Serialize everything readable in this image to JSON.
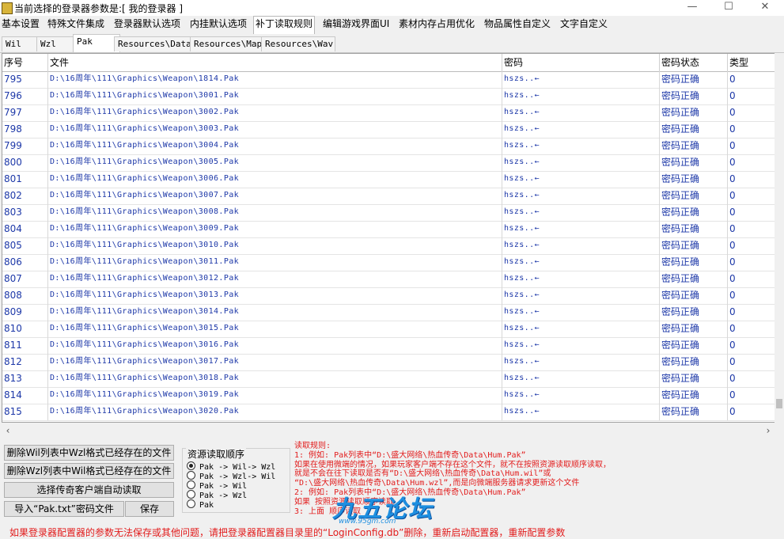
{
  "window": {
    "title": "当前选择的登录器参数是:[ 我的登录器 ]",
    "minimize": "—",
    "maximize": "☐",
    "close": "✕"
  },
  "main_tabs": [
    "基本设置",
    "特殊文件集成",
    "登录器默认选项",
    "内挂默认选项",
    "补丁读取规则",
    "编辑游戏界面UI",
    "素材内存占用优化",
    "物品属性自定义",
    "文字自定义"
  ],
  "active_main_tab": 4,
  "sub_tabs": [
    "Wil",
    "Wzl",
    "Pak",
    "Resources\\Data",
    "Resources\\Map",
    "Resources\\Wav"
  ],
  "active_sub_tab": 2,
  "table": {
    "headers": [
      "序号",
      "文件",
      "密码",
      "密码状态",
      "类型"
    ],
    "rows": [
      {
        "id": "795",
        "file": "D:\\16周年\\111\\Graphics\\Weapon\\1814.Pak",
        "password": "hszs..←",
        "status": "密码正确",
        "type": "0"
      },
      {
        "id": "796",
        "file": "D:\\16周年\\111\\Graphics\\Weapon\\3001.Pak",
        "password": "hszs..←",
        "status": "密码正确",
        "type": "0"
      },
      {
        "id": "797",
        "file": "D:\\16周年\\111\\Graphics\\Weapon\\3002.Pak",
        "password": "hszs..←",
        "status": "密码正确",
        "type": "0"
      },
      {
        "id": "798",
        "file": "D:\\16周年\\111\\Graphics\\Weapon\\3003.Pak",
        "password": "hszs..←",
        "status": "密码正确",
        "type": "0"
      },
      {
        "id": "799",
        "file": "D:\\16周年\\111\\Graphics\\Weapon\\3004.Pak",
        "password": "hszs..←",
        "status": "密码正确",
        "type": "0"
      },
      {
        "id": "800",
        "file": "D:\\16周年\\111\\Graphics\\Weapon\\3005.Pak",
        "password": "hszs..←",
        "status": "密码正确",
        "type": "0"
      },
      {
        "id": "801",
        "file": "D:\\16周年\\111\\Graphics\\Weapon\\3006.Pak",
        "password": "hszs..←",
        "status": "密码正确",
        "type": "0"
      },
      {
        "id": "802",
        "file": "D:\\16周年\\111\\Graphics\\Weapon\\3007.Pak",
        "password": "hszs..←",
        "status": "密码正确",
        "type": "0"
      },
      {
        "id": "803",
        "file": "D:\\16周年\\111\\Graphics\\Weapon\\3008.Pak",
        "password": "hszs..←",
        "status": "密码正确",
        "type": "0"
      },
      {
        "id": "804",
        "file": "D:\\16周年\\111\\Graphics\\Weapon\\3009.Pak",
        "password": "hszs..←",
        "status": "密码正确",
        "type": "0"
      },
      {
        "id": "805",
        "file": "D:\\16周年\\111\\Graphics\\Weapon\\3010.Pak",
        "password": "hszs..←",
        "status": "密码正确",
        "type": "0"
      },
      {
        "id": "806",
        "file": "D:\\16周年\\111\\Graphics\\Weapon\\3011.Pak",
        "password": "hszs..←",
        "status": "密码正确",
        "type": "0"
      },
      {
        "id": "807",
        "file": "D:\\16周年\\111\\Graphics\\Weapon\\3012.Pak",
        "password": "hszs..←",
        "status": "密码正确",
        "type": "0"
      },
      {
        "id": "808",
        "file": "D:\\16周年\\111\\Graphics\\Weapon\\3013.Pak",
        "password": "hszs..←",
        "status": "密码正确",
        "type": "0"
      },
      {
        "id": "809",
        "file": "D:\\16周年\\111\\Graphics\\Weapon\\3014.Pak",
        "password": "hszs..←",
        "status": "密码正确",
        "type": "0"
      },
      {
        "id": "810",
        "file": "D:\\16周年\\111\\Graphics\\Weapon\\3015.Pak",
        "password": "hszs..←",
        "status": "密码正确",
        "type": "0"
      },
      {
        "id": "811",
        "file": "D:\\16周年\\111\\Graphics\\Weapon\\3016.Pak",
        "password": "hszs..←",
        "status": "密码正确",
        "type": "0"
      },
      {
        "id": "812",
        "file": "D:\\16周年\\111\\Graphics\\Weapon\\3017.Pak",
        "password": "hszs..←",
        "status": "密码正确",
        "type": "0"
      },
      {
        "id": "813",
        "file": "D:\\16周年\\111\\Graphics\\Weapon\\3018.Pak",
        "password": "hszs..←",
        "status": "密码正确",
        "type": "0"
      },
      {
        "id": "814",
        "file": "D:\\16周年\\111\\Graphics\\Weapon\\3019.Pak",
        "password": "hszs..←",
        "status": "密码正确",
        "type": "0"
      },
      {
        "id": "815",
        "file": "D:\\16周年\\111\\Graphics\\Weapon\\3020.Pak",
        "password": "hszs..←",
        "status": "密码正确",
        "type": "0"
      }
    ]
  },
  "scroll": {
    "left_arrow": "‹",
    "right_arrow": "›"
  },
  "buttons": {
    "delete_wil": "删除Wil列表中Wzl格式已经存在的文件",
    "delete_wzl": "删除Wzl列表中Wil格式已经存在的文件",
    "select_client": "选择传奇客户端自动读取",
    "import_pak": "导入“Pak.txt”密码文件",
    "save": "保存"
  },
  "resource_order": {
    "title": "资源读取顺序",
    "options": [
      "Pak -> Wil-> Wzl",
      "Pak -> Wzl-> Wil",
      "Pak -> Wil",
      "Pak -> Wzl",
      "Pak"
    ],
    "selected": 0
  },
  "rules": [
    "读取规则:",
    "1: 例如: Pak列表中“D:\\盛大网络\\热血传奇\\Data\\Hum.Pak”",
    "    如果在使用微端的情况，如果玩家客户端不存在这个文件，就不在按照资源读取顺序读取，",
    "    就是不会在往下读取是否有“D:\\盛大网络\\热血传奇\\Data\\Hum.wil”或",
    "  “D:\\盛大网络\\热血传奇\\Data\\Hum.wzl”,而是向微端服务器请求更新这个文件",
    "2: 例如: Pak列表中“D:\\盛大网络\\热血传奇\\Data\\Hum.Pak”",
    "    如果                 按照资源读取顺序读取",
    "3: 上面                   顺序读取"
  ],
  "watermark": {
    "text": "九五论坛",
    "url": "www.95gm.com"
  },
  "footer": "如果登录器配置器的参数无法保存或其他问题，请把登录器配置器目录里的“LoginConfig.db”删除，重新启动配置器，重新配置参数"
}
